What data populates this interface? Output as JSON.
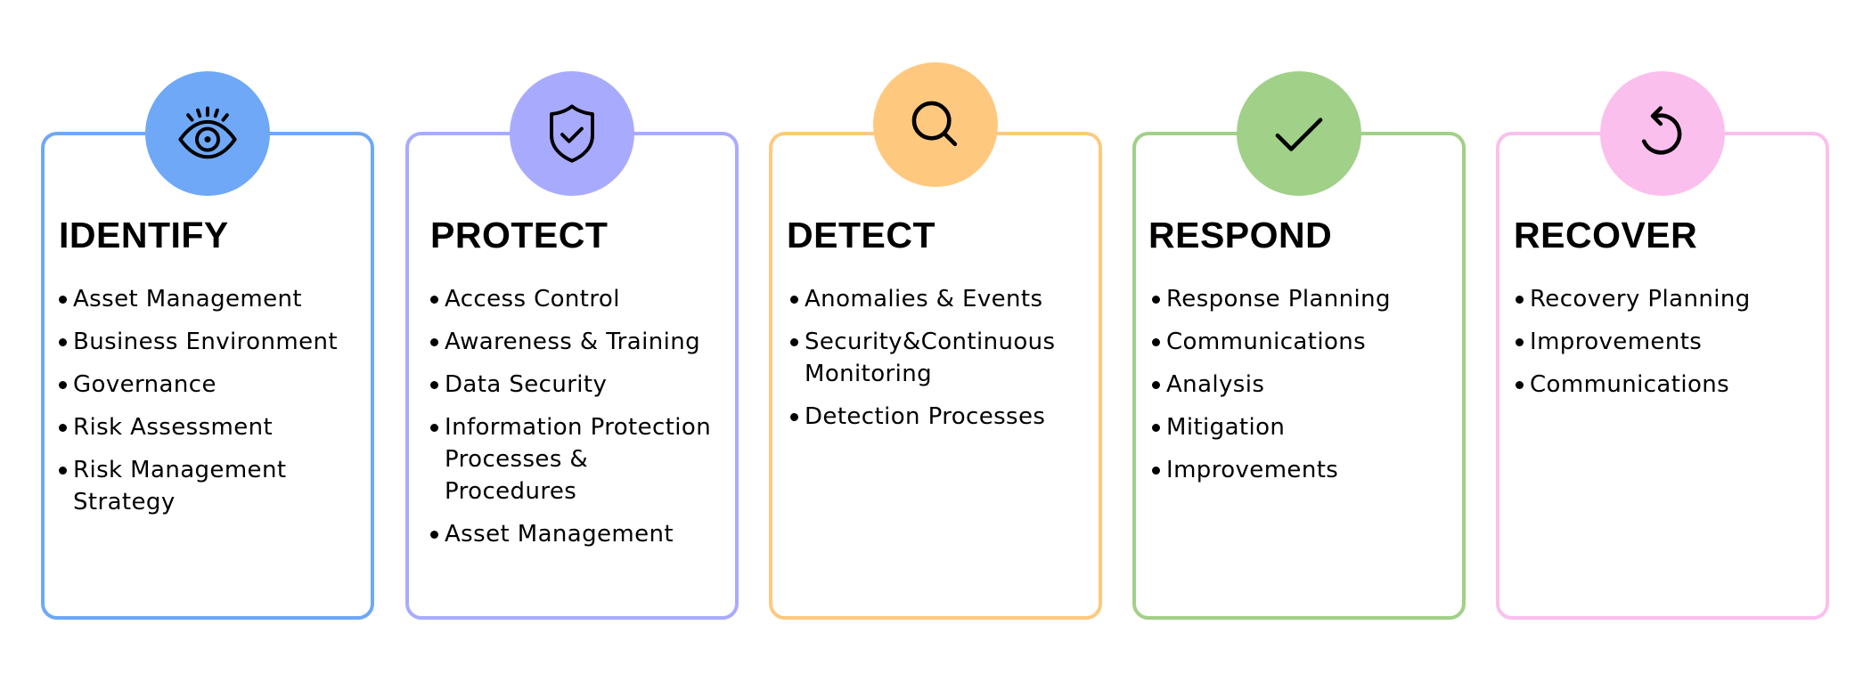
{
  "categories": [
    {
      "id": "identify",
      "title": "IDENTIFY",
      "icon": "eye-icon",
      "color": "#6ea8f7",
      "items": [
        "Asset Management",
        "Business Environment",
        "Governance",
        "Risk Assessment",
        "Risk Management Strategy"
      ]
    },
    {
      "id": "protect",
      "title": "PROTECT",
      "icon": "shield-check-icon",
      "color": "#a8abfd",
      "items": [
        "Access Control",
        "Awareness & Training",
        "Data Security",
        "Information Protection Processes & Procedures",
        "Asset Management"
      ]
    },
    {
      "id": "detect",
      "title": "DETECT",
      "icon": "magnifier-icon",
      "color": "#fec97f",
      "items": [
        "Anomalies & Events",
        "Security&Continuous Monitoring",
        "Detection Processes"
      ]
    },
    {
      "id": "respond",
      "title": "RESPOND",
      "icon": "checkmark-icon",
      "color": "#a1d088",
      "items": [
        "Response Planning",
        "Communications",
        "Analysis",
        "Mitigation",
        "Improvements"
      ]
    },
    {
      "id": "recover",
      "title": "RECOVER",
      "icon": "restore-arrow-icon",
      "color": "#fbbfee",
      "items": [
        "Recovery Planning",
        "Improvements",
        "Communications"
      ]
    }
  ]
}
